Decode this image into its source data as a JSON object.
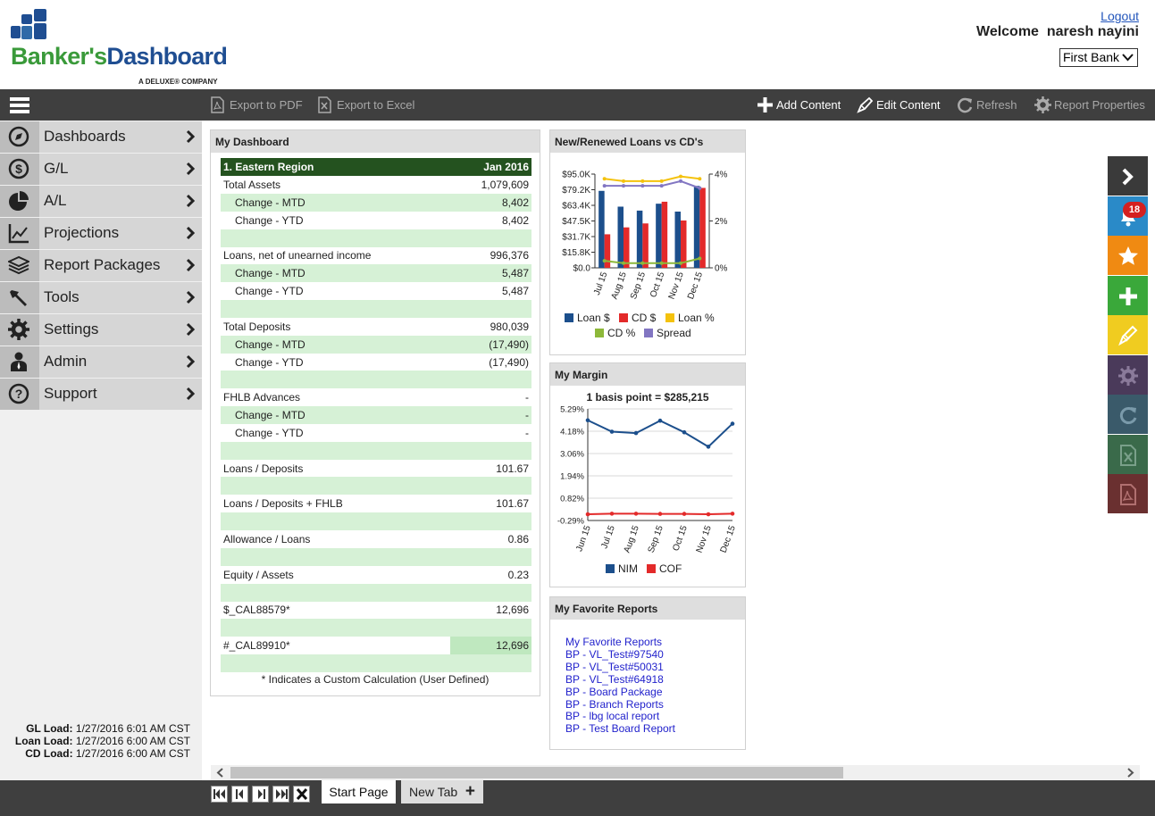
{
  "header": {
    "brand_part1": "Banker's",
    "brand_part2": "Dashboard",
    "brand_tagline": "A DELUXE® COMPANY",
    "logout_label": "Logout",
    "welcome_text": "Welcome  naresh nayini",
    "bank_selected": "First Bank"
  },
  "toolbar": {
    "export_pdf": "Export to PDF",
    "export_excel": "Export to Excel",
    "add_content": "Add Content",
    "edit_content": "Edit Content",
    "refresh": "Refresh",
    "report_properties": "Report Properties"
  },
  "sidebar": {
    "items": [
      {
        "label": "Dashboards",
        "icon": "compass-icon"
      },
      {
        "label": "G/L",
        "icon": "dollar-icon"
      },
      {
        "label": "A/L",
        "icon": "pie-chart-icon"
      },
      {
        "label": "Projections",
        "icon": "line-chart-icon"
      },
      {
        "label": "Report Packages",
        "icon": "layers-icon"
      },
      {
        "label": "Tools",
        "icon": "hammer-icon"
      },
      {
        "label": "Settings",
        "icon": "gear-icon"
      },
      {
        "label": "Admin",
        "icon": "user-icon"
      },
      {
        "label": "Support",
        "icon": "question-icon"
      }
    ],
    "loads": [
      {
        "label": "GL Load:",
        "value": "1/27/2016 6:01 AM CST"
      },
      {
        "label": "Loan Load:",
        "value": "1/27/2016 6:00 AM CST"
      },
      {
        "label": "CD Load:",
        "value": "1/27/2016 6:00 AM CST"
      }
    ]
  },
  "dashboard": {
    "title": "My Dashboard",
    "region": "1. Eastern Region",
    "period": "Jan 2016",
    "rows": [
      {
        "label": "Total Assets",
        "value": "1,079,609",
        "indent": false
      },
      {
        "label": "Change - MTD",
        "value": "8,402",
        "indent": true
      },
      {
        "label": "Change - YTD",
        "value": "8,402",
        "indent": true
      },
      {
        "label": "",
        "value": "",
        "indent": false
      },
      {
        "label": "Loans, net of unearned income",
        "value": "996,376",
        "indent": false
      },
      {
        "label": "Change - MTD",
        "value": "5,487",
        "indent": true
      },
      {
        "label": "Change - YTD",
        "value": "5,487",
        "indent": true
      },
      {
        "label": "",
        "value": "",
        "indent": false
      },
      {
        "label": "Total Deposits",
        "value": "980,039",
        "indent": false
      },
      {
        "label": "Change - MTD",
        "value": "(17,490)",
        "indent": true
      },
      {
        "label": "Change - YTD",
        "value": "(17,490)",
        "indent": true
      },
      {
        "label": "",
        "value": "",
        "indent": false
      },
      {
        "label": "FHLB Advances",
        "value": "-",
        "indent": false
      },
      {
        "label": "Change - MTD",
        "value": "-",
        "indent": true
      },
      {
        "label": "Change - YTD",
        "value": "-",
        "indent": true
      },
      {
        "label": "",
        "value": "",
        "indent": false
      },
      {
        "label": "Loans / Deposits",
        "value": "101.67",
        "indent": false
      },
      {
        "label": "",
        "value": "",
        "indent": false
      },
      {
        "label": "Loans / Deposits + FHLB",
        "value": "101.67",
        "indent": false
      },
      {
        "label": "",
        "value": "",
        "indent": false
      },
      {
        "label": "Allowance / Loans",
        "value": "0.86",
        "indent": false
      },
      {
        "label": "",
        "value": "",
        "indent": false
      },
      {
        "label": "Equity / Assets",
        "value": "0.23",
        "indent": false
      },
      {
        "label": "",
        "value": "",
        "indent": false
      },
      {
        "label": "$_CAL88579*",
        "value": "12,696",
        "indent": false
      },
      {
        "label": "",
        "value": "",
        "indent": false
      },
      {
        "label": "#_CAL89910*",
        "value": "12,696",
        "indent": false,
        "highlight": true
      },
      {
        "label": "",
        "value": "",
        "indent": false
      }
    ],
    "footnote": "* Indicates a Custom Calculation (User Defined)"
  },
  "loans_chart": {
    "title": "New/Renewed Loans vs CD's",
    "chart_data": {
      "type": "bar",
      "categories": [
        "Jul 15",
        "Aug 15",
        "Sep 15",
        "Oct 15",
        "Nov 15",
        "Dec 15"
      ],
      "series": [
        {
          "name": "Loan $",
          "kind": "bar",
          "axis": "left",
          "color": "#1c4f8c",
          "values": [
            78000,
            62000,
            58000,
            65000,
            57000,
            83000
          ]
        },
        {
          "name": "CD $",
          "kind": "bar",
          "axis": "left",
          "color": "#e32a2a",
          "values": [
            34000,
            41000,
            45000,
            67000,
            48000,
            81000
          ]
        },
        {
          "name": "Loan %",
          "kind": "line",
          "axis": "right",
          "color": "#f4c20d",
          "values": [
            3.8,
            3.7,
            3.7,
            3.7,
            3.9,
            3.8
          ]
        },
        {
          "name": "CD %",
          "kind": "line",
          "axis": "right",
          "color": "#8db83a",
          "values": [
            0.3,
            0.2,
            0.2,
            0.2,
            0.2,
            0.4
          ]
        },
        {
          "name": "Spread",
          "kind": "line",
          "axis": "right",
          "color": "#8276c2",
          "values": [
            3.5,
            3.5,
            3.5,
            3.5,
            3.7,
            3.4
          ]
        }
      ],
      "y_left_ticks": [
        "$0.0",
        "$15.8K",
        "$31.7K",
        "$47.5K",
        "$63.4K",
        "$79.2K",
        "$95.0K"
      ],
      "y_left_range": [
        0,
        95000
      ],
      "y_right_ticks": [
        "0%",
        "2%",
        "4%"
      ],
      "y_right_range": [
        0,
        4
      ],
      "legend_position": "bottom"
    }
  },
  "margin_chart": {
    "title": "My Margin",
    "subtitle": "1 basis point = $285,215",
    "chart_data": {
      "type": "line",
      "categories": [
        "Jun 15",
        "Jul 15",
        "Aug 15",
        "Sep 15",
        "Oct 15",
        "Nov 15",
        "Dec 15"
      ],
      "series": [
        {
          "name": "NIM",
          "color": "#1c4f8c",
          "values": [
            4.72,
            4.15,
            4.08,
            4.7,
            4.12,
            3.4,
            4.55
          ]
        },
        {
          "name": "COF",
          "color": "#e32a2a",
          "values": [
            0.02,
            0.05,
            0.05,
            0.04,
            0.04,
            0.02,
            0.05
          ]
        }
      ],
      "y_ticks": [
        "5.29%",
        "4.18%",
        "3.06%",
        "1.94%",
        "0.82%",
        "-0.29%"
      ],
      "ylim": [
        -0.29,
        5.29
      ],
      "grid": true,
      "legend_position": "bottom"
    }
  },
  "favorites": {
    "title": "My Favorite Reports",
    "links": [
      "My Favorite Reports",
      "BP - VL_Test#97540",
      "BP - VL_Test#50031",
      "BP - VL_Test#64918",
      "BP - Board Package",
      "BP - Branch Reports",
      "BP - lbg local report",
      "BP - Test Board Report"
    ]
  },
  "rail": {
    "notification_count": "18",
    "buttons": [
      {
        "name": "expand-rail-button",
        "icon": "chevron-right-icon",
        "color": "#3a3a3a"
      },
      {
        "name": "notifications-button",
        "icon": "bell-icon",
        "color": "#2a8ac8"
      },
      {
        "name": "favorites-button",
        "icon": "star-icon",
        "color": "#f08a12"
      },
      {
        "name": "add-button",
        "icon": "plus-icon",
        "color": "#3aa83a"
      },
      {
        "name": "edit-button",
        "icon": "pencil-icon",
        "color": "#f0cc20"
      },
      {
        "name": "settings-button",
        "icon": "gear-icon",
        "color": "#4a3a5a"
      },
      {
        "name": "refresh-button",
        "icon": "refresh-icon",
        "color": "#3a5a6a"
      },
      {
        "name": "excel-button",
        "icon": "excel-icon",
        "color": "#3a6a4a"
      },
      {
        "name": "pdf-button",
        "icon": "pdf-icon",
        "color": "#6a3030"
      }
    ]
  },
  "bottom": {
    "tab_start": "Start Page",
    "tab_new": "New Tab"
  }
}
